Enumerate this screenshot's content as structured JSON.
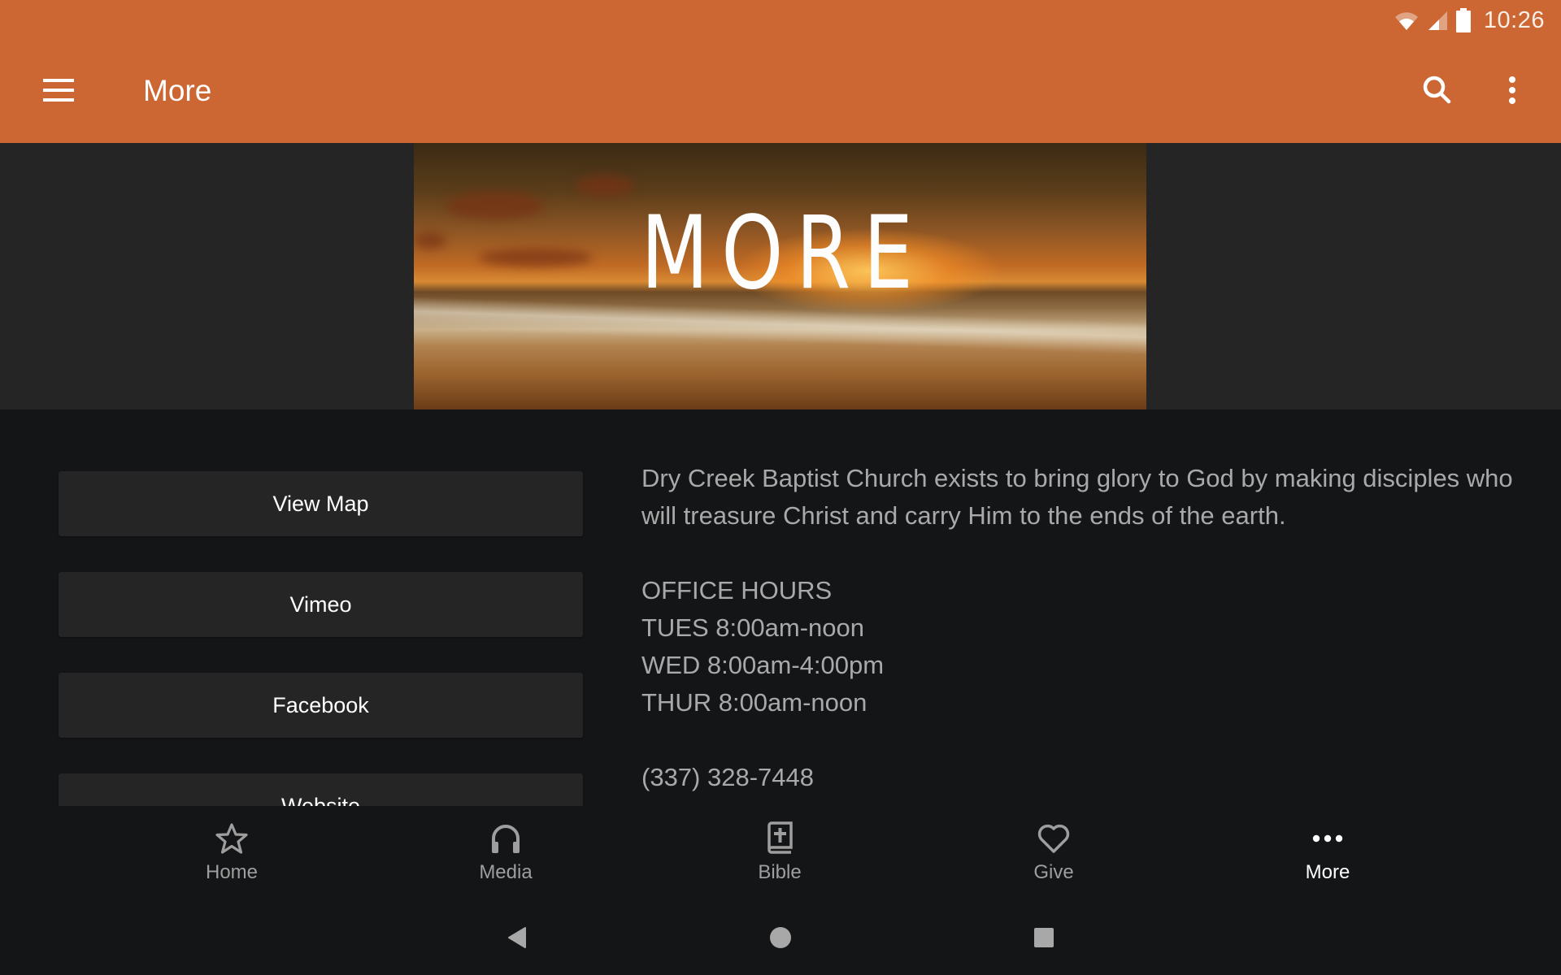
{
  "status_bar": {
    "time": "10:26",
    "icons": [
      "wifi-icon",
      "cell-signal-icon",
      "battery-icon"
    ]
  },
  "toolbar": {
    "title": "More",
    "menu_icon": "hamburger-menu-icon",
    "search_icon": "search-icon",
    "overflow_icon": "more-vert-icon",
    "color": "#cc6633"
  },
  "banner": {
    "title": "MORE",
    "image_description": "sunset over ocean beach"
  },
  "links": [
    {
      "label": "View Map"
    },
    {
      "label": "Vimeo"
    },
    {
      "label": "Facebook"
    },
    {
      "label": "Website"
    }
  ],
  "info": {
    "mission": "Dry Creek Baptist Church exists to bring glory to God by making disciples who will treasure Christ and carry Him to the ends of the earth.",
    "office_hours_title": "OFFICE HOURS",
    "hours": [
      "TUES 8:00am-noon",
      "WED 8:00am-4:00pm",
      "THUR 8:00am-noon"
    ],
    "phone": "(337) 328-7448"
  },
  "bottom_nav": {
    "active": "More",
    "tabs": [
      {
        "label": "Home",
        "icon": "star-icon"
      },
      {
        "label": "Media",
        "icon": "headphones-icon"
      },
      {
        "label": "Bible",
        "icon": "bible-icon"
      },
      {
        "label": "Give",
        "icon": "heart-icon"
      },
      {
        "label": "More",
        "icon": "more-horiz-icon"
      }
    ]
  },
  "system_nav": {
    "back": "back-icon",
    "home": "home-circle-icon",
    "recents": "recents-square-icon"
  }
}
